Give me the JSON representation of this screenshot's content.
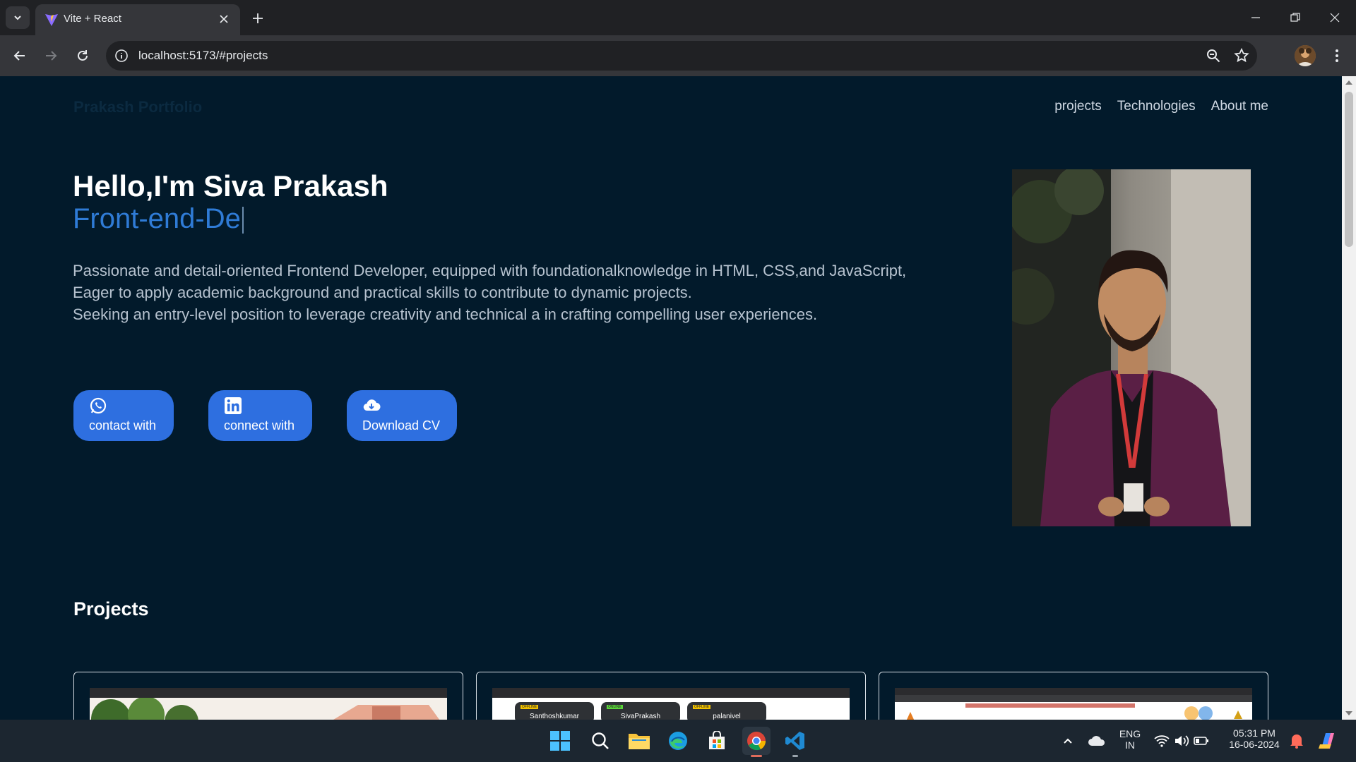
{
  "browser": {
    "tab_title": "Vite + React",
    "url": "localhost:5173/#projects"
  },
  "site": {
    "brand": "Prakash Portfolio",
    "nav": [
      "projects",
      "Technologies",
      "About me"
    ]
  },
  "hero": {
    "greeting": "Hello,I'm Siva Prakash",
    "typed_role": "Front-end-De",
    "description_lines": [
      "Passionate and detail-oriented Frontend Developer, equipped with foundationalknowledge in HTML, CSS,and JavaScript,",
      "Eager to apply academic background and practical skills to contribute to dynamic projects.",
      "Seeking an entry-level position to leverage creativity and technical a in crafting compelling user experiences."
    ],
    "buttons": {
      "whatsapp": "contact with",
      "linkedin": "connect with",
      "cv": "Download CV"
    }
  },
  "projects": {
    "title": "Projects",
    "card2_labels": [
      "Santhoshkumar",
      "SivaPrakash",
      "palanivel"
    ]
  },
  "taskbar": {
    "lang_top": "ENG",
    "lang_bottom": "IN",
    "time": "05:31 PM",
    "date": "16-06-2024"
  },
  "colors": {
    "page_bg": "#021a2b",
    "accent": "#2e6fe0",
    "role_text": "#2f7bd6"
  }
}
